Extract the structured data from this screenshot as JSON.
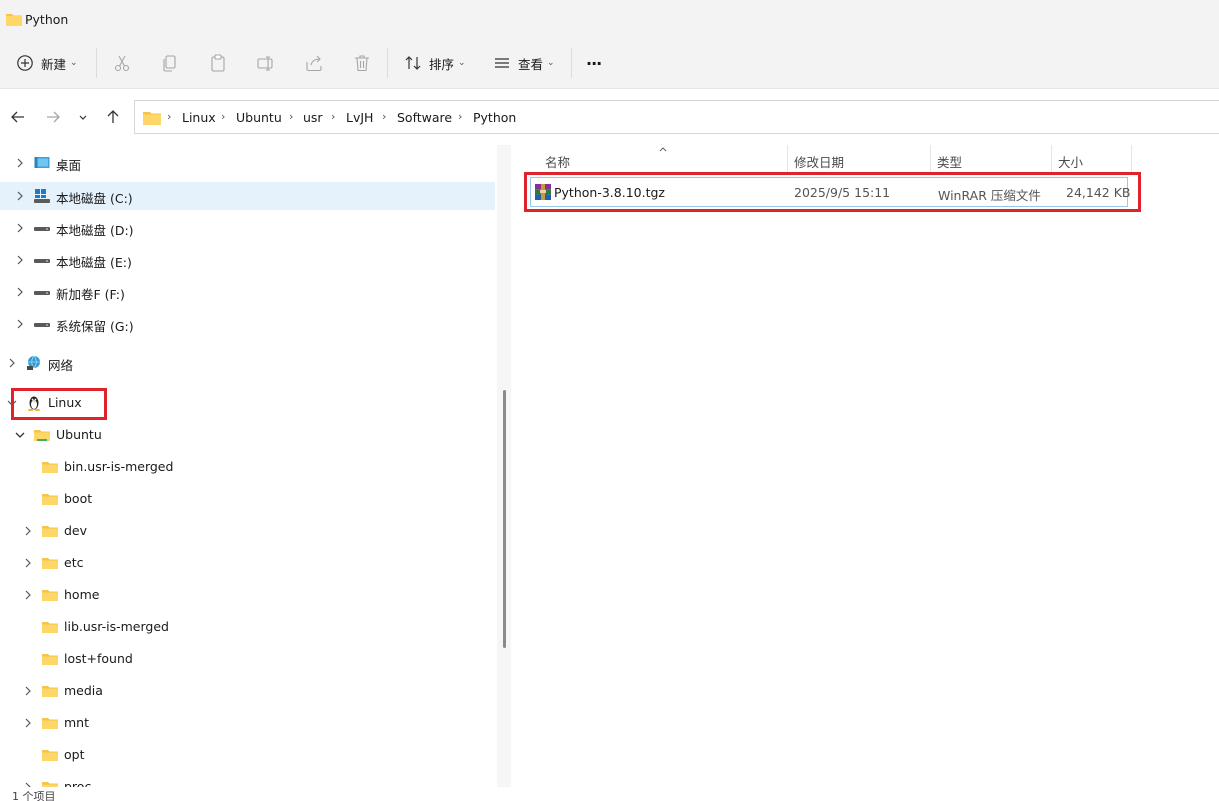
{
  "window": {
    "title": "Python"
  },
  "toolbar": {
    "new_label": "新建",
    "sort_label": "排序",
    "view_label": "查看",
    "more_label": "···"
  },
  "address": {
    "crumbs": [
      "Linux",
      "Ubuntu",
      "usr",
      "LvJH",
      "Software",
      "Python"
    ]
  },
  "nav": {
    "items": [
      {
        "label": "桌面",
        "icon": "desktop-icon"
      },
      {
        "label": "本地磁盘 (C:)",
        "icon": "windows-drive-icon",
        "selected": true
      },
      {
        "label": "本地磁盘 (D:)",
        "icon": "drive-icon"
      },
      {
        "label": "本地磁盘 (E:)",
        "icon": "drive-icon"
      },
      {
        "label": "新加卷F (F:)",
        "icon": "drive-icon"
      },
      {
        "label": "系统保留 (G:)",
        "icon": "drive-icon"
      },
      {
        "label": "网络",
        "icon": "network-icon"
      },
      {
        "label": "Linux",
        "icon": "linux-penguin-icon"
      },
      {
        "label": "Ubuntu",
        "icon": "folder-icon"
      },
      {
        "label": "bin.usr-is-merged",
        "icon": "folder-icon"
      },
      {
        "label": "boot",
        "icon": "folder-icon"
      },
      {
        "label": "dev",
        "icon": "folder-icon"
      },
      {
        "label": "etc",
        "icon": "folder-icon"
      },
      {
        "label": "home",
        "icon": "folder-icon"
      },
      {
        "label": "lib.usr-is-merged",
        "icon": "folder-icon"
      },
      {
        "label": "lost+found",
        "icon": "folder-icon"
      },
      {
        "label": "media",
        "icon": "folder-icon"
      },
      {
        "label": "mnt",
        "icon": "folder-icon"
      },
      {
        "label": "opt",
        "icon": "folder-icon"
      },
      {
        "label": "proc",
        "icon": "folder-icon"
      }
    ]
  },
  "columns": {
    "name": "名称",
    "modified": "修改日期",
    "type": "类型",
    "size": "大小"
  },
  "files": [
    {
      "name": "Python-3.8.10.tgz",
      "modified": "2025/9/5 15:11",
      "type": "WinRAR 压缩文件",
      "size": "24,142 KB",
      "icon": "winrar-archive-icon"
    }
  ],
  "status": {
    "count": "1 个项目"
  },
  "colors": {
    "accent": "#0067c0",
    "annotation": "#e0232a",
    "selected_bg": "#e5f1fb"
  }
}
